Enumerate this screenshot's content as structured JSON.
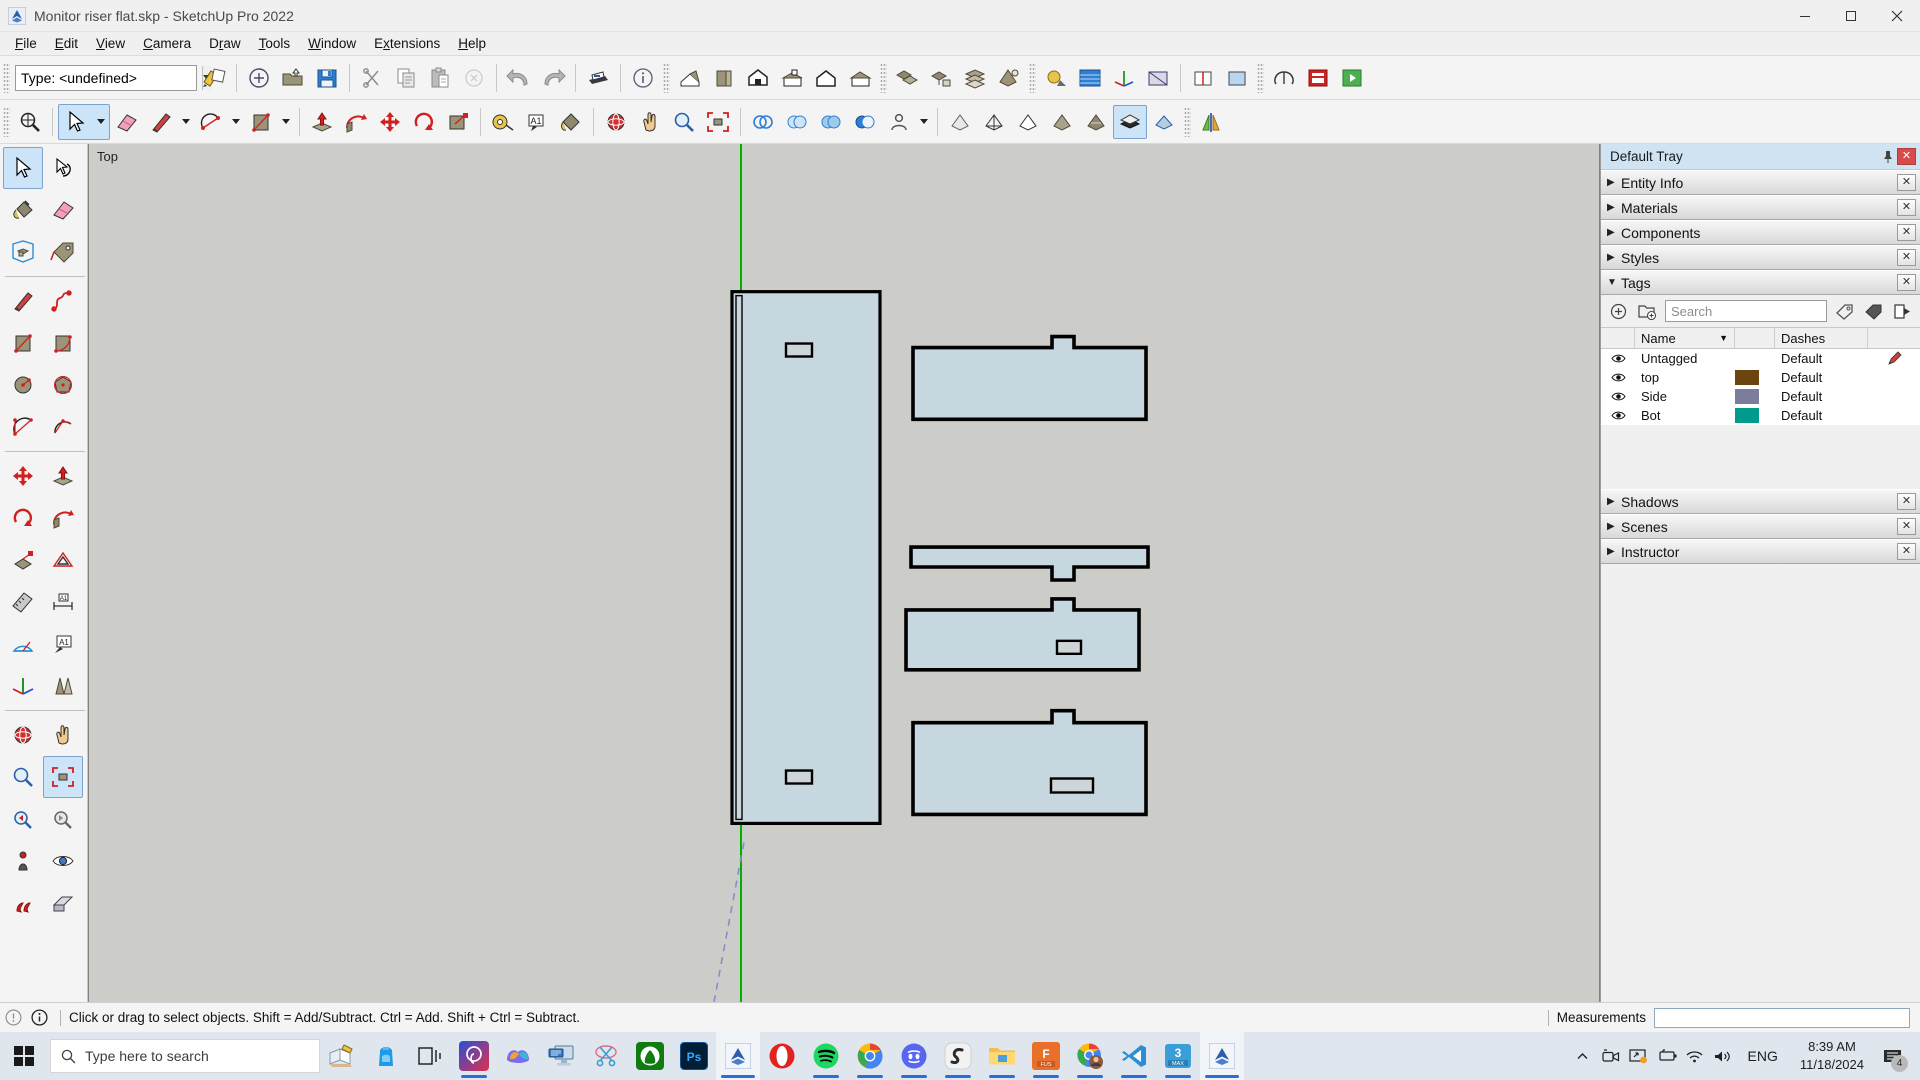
{
  "window": {
    "title": "Monitor riser flat.skp - SketchUp Pro 2022",
    "app_icon": "sketchup-icon",
    "minimize": "—",
    "maximize": "□",
    "close": "✕"
  },
  "menubar": {
    "items": [
      {
        "label": "File",
        "accel": "F"
      },
      {
        "label": "Edit",
        "accel": "E"
      },
      {
        "label": "View",
        "accel": "V"
      },
      {
        "label": "Camera",
        "accel": "C"
      },
      {
        "label": "Draw",
        "accel": "r"
      },
      {
        "label": "Tools",
        "accel": "T"
      },
      {
        "label": "Window",
        "accel": "W"
      },
      {
        "label": "Extensions",
        "accel": "x"
      },
      {
        "label": "Help",
        "accel": "H"
      }
    ]
  },
  "toolbar_top": {
    "type_selector": {
      "value": "Type: <undefined>",
      "placeholder": ""
    },
    "buttons": [
      {
        "name": "layers-edit-icon",
        "title": "Edit Tag"
      },
      {
        "name": "new-icon",
        "title": "New"
      },
      {
        "name": "open-icon",
        "title": "Open"
      },
      {
        "name": "save-icon",
        "title": "Save"
      },
      {
        "name": "cut-icon",
        "title": "Cut"
      },
      {
        "name": "copy-icon",
        "title": "Copy"
      },
      {
        "name": "paste-icon",
        "title": "Paste"
      },
      {
        "name": "erase-icon",
        "title": "Erase"
      },
      {
        "name": "undo-icon",
        "title": "Undo"
      },
      {
        "name": "redo-icon",
        "title": "Redo"
      },
      {
        "name": "print-icon",
        "title": "Print"
      },
      {
        "name": "model-info-icon",
        "title": "Model Info"
      },
      {
        "name": "iso-view-icon",
        "title": "Iso"
      },
      {
        "name": "top-view-icon",
        "title": "Top"
      },
      {
        "name": "front-view-icon",
        "title": "Front"
      },
      {
        "name": "right-view-icon",
        "title": "Right"
      },
      {
        "name": "back-view-icon",
        "title": "Back"
      },
      {
        "name": "left-view-icon",
        "title": "Left"
      },
      {
        "name": "components-icon",
        "title": "Components"
      },
      {
        "name": "outliner-icon",
        "title": "Outliner"
      },
      {
        "name": "layers-icon",
        "title": "Tags"
      },
      {
        "name": "styles-icon",
        "title": "Styles"
      },
      {
        "name": "shadows-icon",
        "title": "Shadows"
      },
      {
        "name": "fog-icon",
        "title": "Fog"
      },
      {
        "name": "axes-icon",
        "title": "Axes"
      },
      {
        "name": "section-plane-icon",
        "title": "Section Plane"
      },
      {
        "name": "display-section-cuts-icon",
        "title": "Display Section Cuts"
      },
      {
        "name": "display-section-fill-icon",
        "title": "Display Section Fill"
      },
      {
        "name": "extension-warehouse-icon",
        "title": "Extension Warehouse"
      },
      {
        "name": "layout-icon",
        "title": "LayOut"
      },
      {
        "name": "play-icon",
        "title": "Run"
      }
    ]
  },
  "toolbar_second": {
    "buttons": [
      {
        "name": "zoom-selection-icon",
        "title": "Zoom Selection"
      },
      {
        "name": "select-icon",
        "title": "Select",
        "active": true
      },
      {
        "name": "eraser-icon",
        "title": "Eraser"
      },
      {
        "name": "line-icon",
        "title": "Line"
      },
      {
        "name": "arc-icon",
        "title": "Arc"
      },
      {
        "name": "rectangle-icon",
        "title": "Rectangle"
      },
      {
        "name": "pushpull-icon",
        "title": "Push/Pull"
      },
      {
        "name": "followme-icon",
        "title": "Follow Me"
      },
      {
        "name": "move-icon",
        "title": "Move"
      },
      {
        "name": "rotate-icon",
        "title": "Rotate"
      },
      {
        "name": "scale-icon",
        "title": "Scale"
      },
      {
        "name": "tape-measure-icon",
        "title": "Tape Measure"
      },
      {
        "name": "text-icon",
        "title": "Text"
      },
      {
        "name": "paint-bucket-icon",
        "title": "Paint Bucket"
      },
      {
        "name": "orbit-icon",
        "title": "Orbit"
      },
      {
        "name": "pan-icon",
        "title": "Pan"
      },
      {
        "name": "zoom-icon",
        "title": "Zoom"
      },
      {
        "name": "zoom-extents-icon",
        "title": "Zoom Extents"
      },
      {
        "name": "solid-tools-icon",
        "title": "Solid Tools"
      },
      {
        "name": "intersect-icon",
        "title": "Intersect"
      },
      {
        "name": "union-icon",
        "title": "Union"
      },
      {
        "name": "subtract-icon",
        "title": "Subtract"
      },
      {
        "name": "person-icon",
        "title": "Position Camera"
      },
      {
        "name": "style-xray-icon",
        "title": "X-Ray"
      },
      {
        "name": "style-wireframe-icon",
        "title": "Wireframe"
      },
      {
        "name": "style-hidden-line-icon",
        "title": "Hidden Line"
      },
      {
        "name": "style-shaded-icon",
        "title": "Shaded"
      },
      {
        "name": "style-texture-icon",
        "title": "Shaded With Textures"
      },
      {
        "name": "style-monochrome-icon",
        "title": "Monochrome",
        "active": true
      },
      {
        "name": "style-back-edges-icon",
        "title": "Back Edges"
      },
      {
        "name": "mirror-icon",
        "title": "Mirror"
      }
    ]
  },
  "left_toolbar": {
    "buttons": [
      {
        "name": "select-tool-icon",
        "title": "Select",
        "active": true
      },
      {
        "name": "lasso-select-icon",
        "title": "Lasso Select"
      },
      {
        "name": "paint-bucket-tool-icon",
        "title": "Paint Bucket"
      },
      {
        "name": "eraser-tool-icon",
        "title": "Eraser"
      },
      {
        "name": "component-tool-icon",
        "title": "Make Component"
      },
      {
        "name": "tag-tool-icon",
        "title": "Tag Tool"
      },
      {
        "name": "line-tool-icon",
        "title": "Line"
      },
      {
        "name": "freehand-tool-icon",
        "title": "Freehand"
      },
      {
        "name": "rectangle-tool-icon",
        "title": "Rectangle"
      },
      {
        "name": "rotated-rectangle-tool-icon",
        "title": "Rotated Rectangle"
      },
      {
        "name": "circle-tool-icon",
        "title": "Circle"
      },
      {
        "name": "polygon-tool-icon",
        "title": "Polygon"
      },
      {
        "name": "arc-tool-icon",
        "title": "Arc"
      },
      {
        "name": "two-point-arc-tool-icon",
        "title": "2 Point Arc"
      },
      {
        "name": "move-tool-icon",
        "title": "Move"
      },
      {
        "name": "pushpull-tool-icon",
        "title": "Push/Pull"
      },
      {
        "name": "rotate-tool-icon",
        "title": "Rotate"
      },
      {
        "name": "followme-tool-icon",
        "title": "Follow Me"
      },
      {
        "name": "scale-tool-icon",
        "title": "Scale"
      },
      {
        "name": "offset-tool-icon",
        "title": "Offset"
      },
      {
        "name": "tape-measure-tool-icon",
        "title": "Tape Measure"
      },
      {
        "name": "dimension-tool-icon",
        "title": "Dimension"
      },
      {
        "name": "protractor-tool-icon",
        "title": "Protractor"
      },
      {
        "name": "text-tool-icon",
        "title": "Text"
      },
      {
        "name": "axes-tool-icon",
        "title": "Axes"
      },
      {
        "name": "3d-text-tool-icon",
        "title": "3D Text"
      },
      {
        "name": "orbit-tool-icon",
        "title": "Orbit"
      },
      {
        "name": "pan-tool-icon",
        "title": "Pan"
      },
      {
        "name": "zoom-tool-icon",
        "title": "Zoom"
      },
      {
        "name": "zoom-extents-tool-icon",
        "title": "Zoom Extents",
        "active": true
      },
      {
        "name": "previous-view-tool-icon",
        "title": "Previous View"
      },
      {
        "name": "next-view-tool-icon",
        "title": "Next View"
      },
      {
        "name": "position-camera-tool-icon",
        "title": "Position Camera"
      },
      {
        "name": "look-around-tool-icon",
        "title": "Look Around"
      },
      {
        "name": "walk-tool-icon",
        "title": "Walk"
      },
      {
        "name": "section-plane-tool-icon",
        "title": "Section Plane"
      }
    ]
  },
  "viewport": {
    "view_label": "Top",
    "background": "#cccdc8",
    "face_fill": "#c7d7e0",
    "edge_color": "#000000",
    "axis_green": "#00b000",
    "axis_dashed": "#8a8acd"
  },
  "tray": {
    "title": "Default Tray",
    "pin_icon": "pin-icon",
    "close_icon": "close-icon",
    "panels_above": [
      {
        "label": "Entity Info",
        "expanded": false
      },
      {
        "label": "Materials",
        "expanded": false
      },
      {
        "label": "Components",
        "expanded": false
      },
      {
        "label": "Styles",
        "expanded": false
      }
    ],
    "tags_panel": {
      "label": "Tags",
      "expanded": true,
      "tools": [
        {
          "name": "add-tag-icon",
          "title": "Add Tag"
        },
        {
          "name": "add-tag-folder-icon",
          "title": "Add Tag Folder"
        },
        {
          "name": "tag-details-icon",
          "title": "Details"
        },
        {
          "name": "select-all-icon",
          "title": "Select All"
        },
        {
          "name": "tag-export-icon",
          "title": "Export"
        }
      ],
      "search": {
        "value": "",
        "placeholder": "Search"
      },
      "columns": [
        "",
        "Name",
        "",
        "Dashes",
        ""
      ],
      "rows": [
        {
          "visible": true,
          "name": "Untagged",
          "color": null,
          "dashes": "Default",
          "active": true
        },
        {
          "visible": true,
          "name": "top",
          "color": "#6b4410",
          "dashes": "Default",
          "active": false
        },
        {
          "visible": true,
          "name": "Side",
          "color": "#7c7c9c",
          "dashes": "Default",
          "active": false
        },
        {
          "visible": true,
          "name": "Bot",
          "color": "#009b8c",
          "dashes": "Default",
          "active": false
        }
      ]
    },
    "panels_below": [
      {
        "label": "Shadows",
        "expanded": false
      },
      {
        "label": "Scenes",
        "expanded": false
      },
      {
        "label": "Instructor",
        "expanded": false
      }
    ]
  },
  "statusbar": {
    "help_icon": "help-icon",
    "info_icon": "info-icon",
    "message": "Click or drag to select objects. Shift = Add/Subtract. Ctrl = Add. Shift + Ctrl = Subtract.",
    "measurements_label": "Measurements",
    "measurements_value": "",
    "measurements_placeholder": ""
  },
  "taskbar": {
    "start_icon": "windows-start-icon",
    "search": {
      "value": "",
      "placeholder": "Type here to search"
    },
    "pinned_left": [
      {
        "name": "cortana-icon",
        "title": "Cortana"
      },
      {
        "name": "onedrive-backpack-icon",
        "title": "Backup"
      }
    ],
    "apps": [
      {
        "name": "task-view-icon",
        "title": "Task View",
        "state": "none"
      },
      {
        "name": "ai-assistant-icon",
        "title": "AI Assistant",
        "state": "open"
      },
      {
        "name": "copilot-icon",
        "title": "Copilot",
        "state": "none"
      },
      {
        "name": "remote-desktop-icon",
        "title": "Remote Desktop",
        "state": "none"
      },
      {
        "name": "snipping-tool-icon",
        "title": "Snipping Tool",
        "state": "none"
      },
      {
        "name": "xbox-icon",
        "title": "Xbox",
        "state": "none"
      },
      {
        "name": "photoshop-icon",
        "title": "Adobe Photoshop",
        "state": "none"
      },
      {
        "name": "sketchup-taskbar-icon",
        "title": "SketchUp",
        "state": "focus"
      },
      {
        "name": "opera-icon",
        "title": "Opera",
        "state": "none"
      },
      {
        "name": "spotify-icon",
        "title": "Spotify",
        "state": "open"
      },
      {
        "name": "chrome-icon",
        "title": "Google Chrome",
        "state": "open"
      },
      {
        "name": "discord-icon",
        "title": "Discord",
        "state": "open"
      },
      {
        "name": "epic-games-icon",
        "title": "Epic Games",
        "state": "open"
      },
      {
        "name": "file-explorer-icon",
        "title": "File Explorer",
        "state": "open"
      },
      {
        "name": "fusion360-icon",
        "title": "Fusion 360",
        "state": "open"
      },
      {
        "name": "chrome-profile-icon",
        "title": "Chrome",
        "state": "open"
      },
      {
        "name": "vscode-icon",
        "title": "Visual Studio Code",
        "state": "open"
      },
      {
        "name": "3dsmax-icon",
        "title": "3ds Max",
        "state": "open"
      },
      {
        "name": "sketchup-active-icon",
        "title": "SketchUp Pro 2022",
        "state": "focus"
      }
    ],
    "systray": [
      {
        "name": "show-hidden-icons-icon",
        "title": "Show hidden icons"
      },
      {
        "name": "camera-icon",
        "title": "Camera"
      },
      {
        "name": "onedrive-sync-icon",
        "title": "OneDrive"
      },
      {
        "name": "battery-icon",
        "title": "Battery"
      },
      {
        "name": "wifi-icon",
        "title": "Network"
      },
      {
        "name": "volume-icon",
        "title": "Volume"
      }
    ],
    "language": "ENG",
    "time": "8:39 AM",
    "date": "11/18/2024",
    "notifications": {
      "icon": "notification-icon",
      "count": "4"
    }
  }
}
